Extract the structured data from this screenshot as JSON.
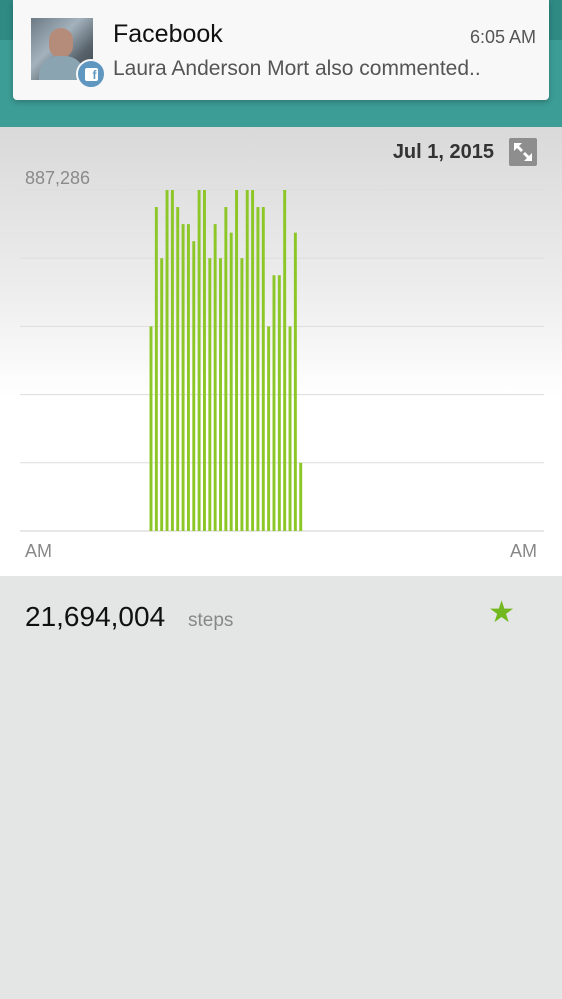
{
  "notification": {
    "app": "Facebook",
    "time": "6:05 AM",
    "text": "Laura Anderson Mort also commented..",
    "badge_icon": "facebook-badge-icon",
    "badge_letter": "f"
  },
  "chart_data": {
    "type": "bar",
    "date": "Jul 1, 2015",
    "ymax_label": "887,286",
    "ylim": [
      0,
      887286
    ],
    "grid": true,
    "x_tick_labels": [
      "AM",
      "AM"
    ],
    "color": "#8dc727",
    "values": [
      0,
      0,
      0,
      0,
      0,
      0,
      0,
      0,
      0,
      0,
      0,
      0,
      0,
      0,
      0,
      0,
      0,
      0,
      0,
      0,
      0,
      0,
      0,
      0,
      532372,
      842922,
      709829,
      887286,
      887286,
      842922,
      798557,
      798557,
      754193,
      887286,
      887286,
      709829,
      798557,
      709829,
      842922,
      776375,
      887286,
      709829,
      887286,
      887286,
      842922,
      842922,
      532372,
      665465,
      665465,
      887286,
      532372,
      776375,
      177457,
      0,
      0,
      0,
      0,
      0,
      0,
      0,
      0,
      0,
      0,
      0,
      0,
      0,
      0,
      0,
      0,
      0,
      0,
      0,
      0,
      0,
      0,
      0,
      0,
      0,
      0,
      0,
      0,
      0,
      0,
      0,
      0,
      0,
      0,
      0,
      0,
      0,
      0,
      0,
      0,
      0,
      0,
      0,
      0,
      0
    ]
  },
  "summary": {
    "steps": "21,694,004",
    "unit": "steps",
    "star_icon": "star-icon",
    "star_color": "#73b81f"
  }
}
